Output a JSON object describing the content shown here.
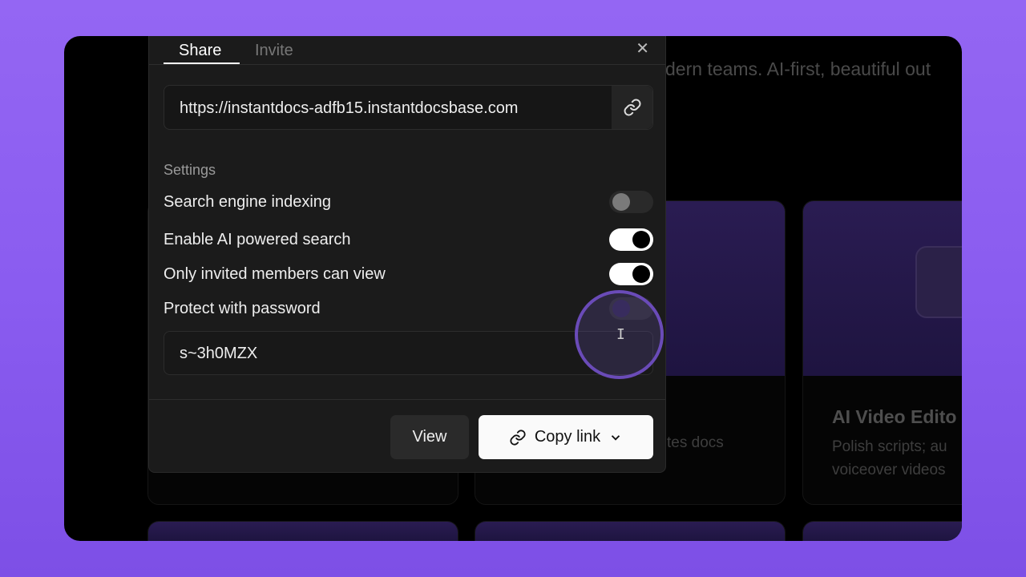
{
  "background": {
    "tagline": "dern teams. AI-first, beautiful out",
    "card_text": "tes docs",
    "card_ai_video": {
      "title": "AI Video Edito",
      "description_lines": [
        "Polish scripts; au",
        "voiceover videos"
      ]
    }
  },
  "dialog": {
    "tabs": [
      {
        "label": "Share",
        "active": true
      },
      {
        "label": "Invite",
        "active": false
      }
    ],
    "close_icon": "x-icon",
    "url": "https://instantdocs-adfb15.instantdocsbase.com",
    "url_button_icon": "link-icon",
    "settings_label": "Settings",
    "settings": [
      {
        "label": "Search engine indexing",
        "enabled": false
      },
      {
        "label": "Enable AI powered search",
        "enabled": true
      },
      {
        "label": "Only invited members can view",
        "enabled": true
      },
      {
        "label": "Protect with password",
        "enabled": false
      }
    ],
    "password_value": "s~3h0MZX",
    "view_label": "View",
    "copy_link_label": "Copy link"
  },
  "colors": {
    "accent": "#8b5cf6",
    "dialog_bg": "#1b1b1b"
  }
}
